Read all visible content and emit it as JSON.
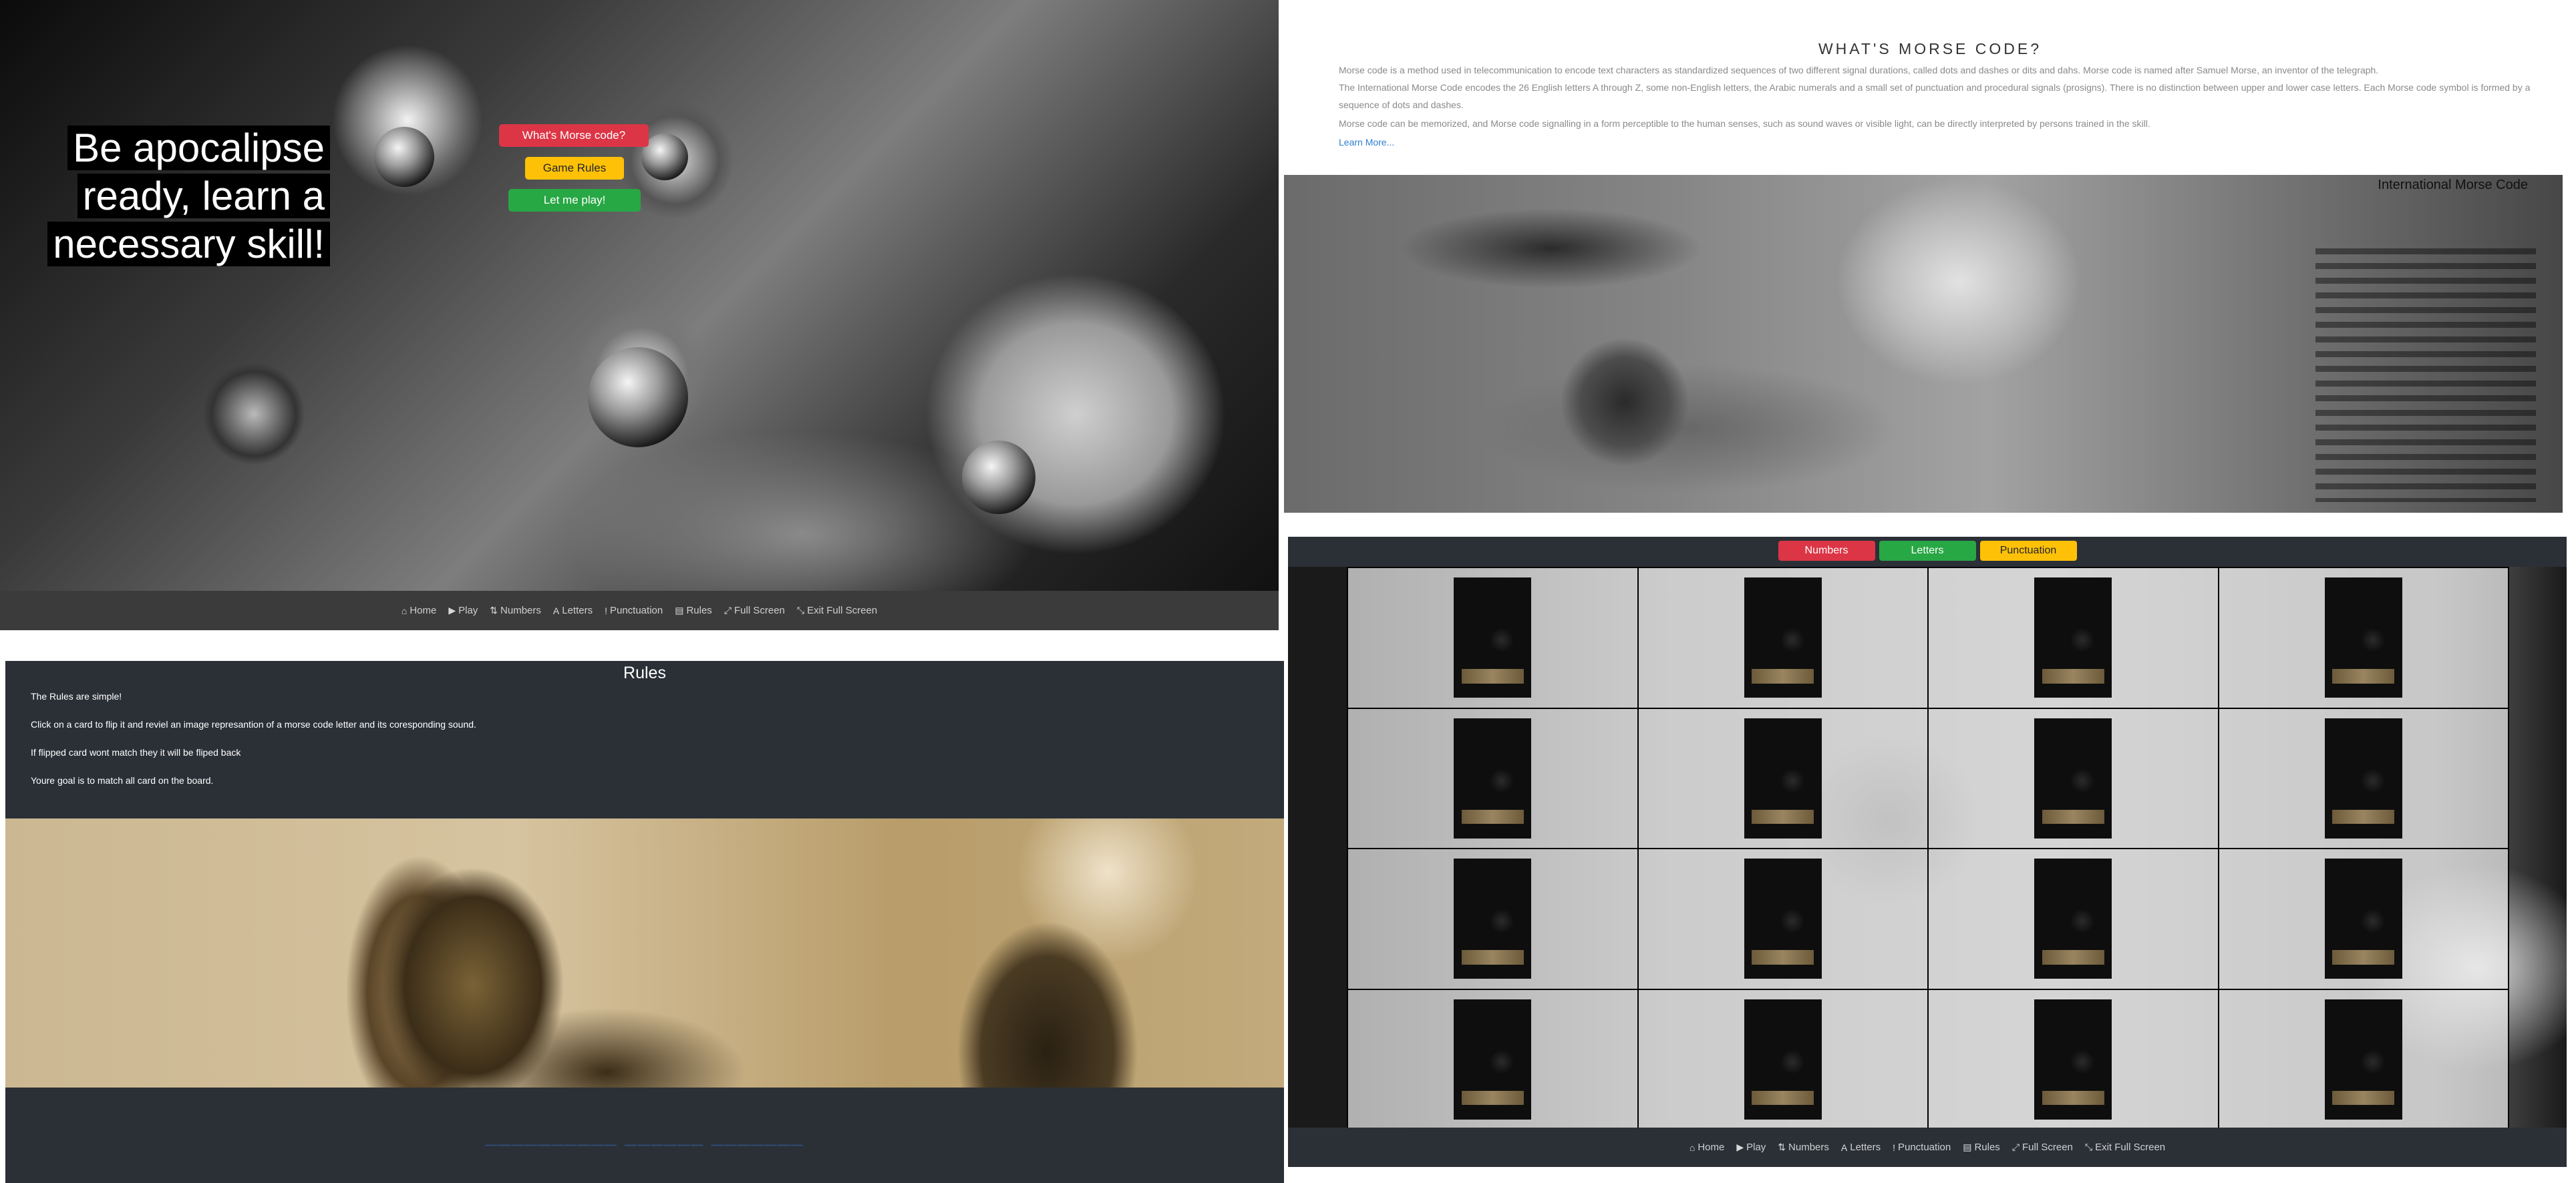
{
  "hero": {
    "heading_lines": [
      "Be apocalipse",
      "ready, learn a",
      "necessary skill!"
    ],
    "buttons": {
      "morse_label": "What's Morse code?",
      "rules_label": "Game Rules",
      "play_label": "Let me play!"
    },
    "button_colors": {
      "morse": "#dc3545",
      "rules": "#ffc107",
      "play": "#28a745"
    }
  },
  "navbar": {
    "items": [
      {
        "label": "Home",
        "icon": "home-icon"
      },
      {
        "label": "Play",
        "icon": "play-icon"
      },
      {
        "label": "Numbers",
        "icon": "sort-numeric-icon"
      },
      {
        "label": "Letters",
        "icon": "font-icon"
      },
      {
        "label": "Punctuation",
        "icon": "exclamation-icon"
      },
      {
        "label": "Rules",
        "icon": "book-icon"
      },
      {
        "label": "Full Screen",
        "icon": "expand-icon"
      },
      {
        "label": "Exit Full Screen",
        "icon": "compress-icon"
      }
    ]
  },
  "rules": {
    "title": "Rules",
    "lines": [
      "The Rules are simple!",
      "Click on a card to flip it and reviel an image represantion of a morse code letter and its coresponding sound.",
      "If flipped card wont match they it will be fliped back",
      "Youre goal is to match all card on the board."
    ],
    "footer_link": "__________ ______ _______"
  },
  "about": {
    "title": "WHAT'S MORSE CODE?",
    "paragraphs": [
      "Morse code is a method used in telecommunication to encode text characters as standardized sequences of two different signal durations, called dots and dashes or dits and dahs. Morse code is named after Samuel Morse, an inventor of the telegraph.",
      "The International Morse Code encodes the 26 English letters A through Z, some non-English letters, the Arabic numerals and a small set of punctuation and procedural signals (prosigns). There is no distinction between upper and lower case letters. Each Morse code symbol is formed by a sequence of dots and dashes.",
      "Morse code can be memorized, and Morse code signalling in a form perceptible to the human senses, such as sound waves or visible light, can be directly interpreted by persons trained in the skill."
    ],
    "learn_more": "Learn More...",
    "chart_title": "International Morse Code"
  },
  "game": {
    "tabs": [
      {
        "label": "Numbers",
        "color": "#dc3545"
      },
      {
        "label": "Letters",
        "color": "#28a745"
      },
      {
        "label": "Punctuation",
        "color": "#ffc107"
      }
    ],
    "board": {
      "rows": 4,
      "columns": 4,
      "card_state": "face-down"
    }
  },
  "colors": {
    "dark_panel": "#2b3037",
    "navbar": "#3b3b3b",
    "link": "#2f7fd0"
  }
}
